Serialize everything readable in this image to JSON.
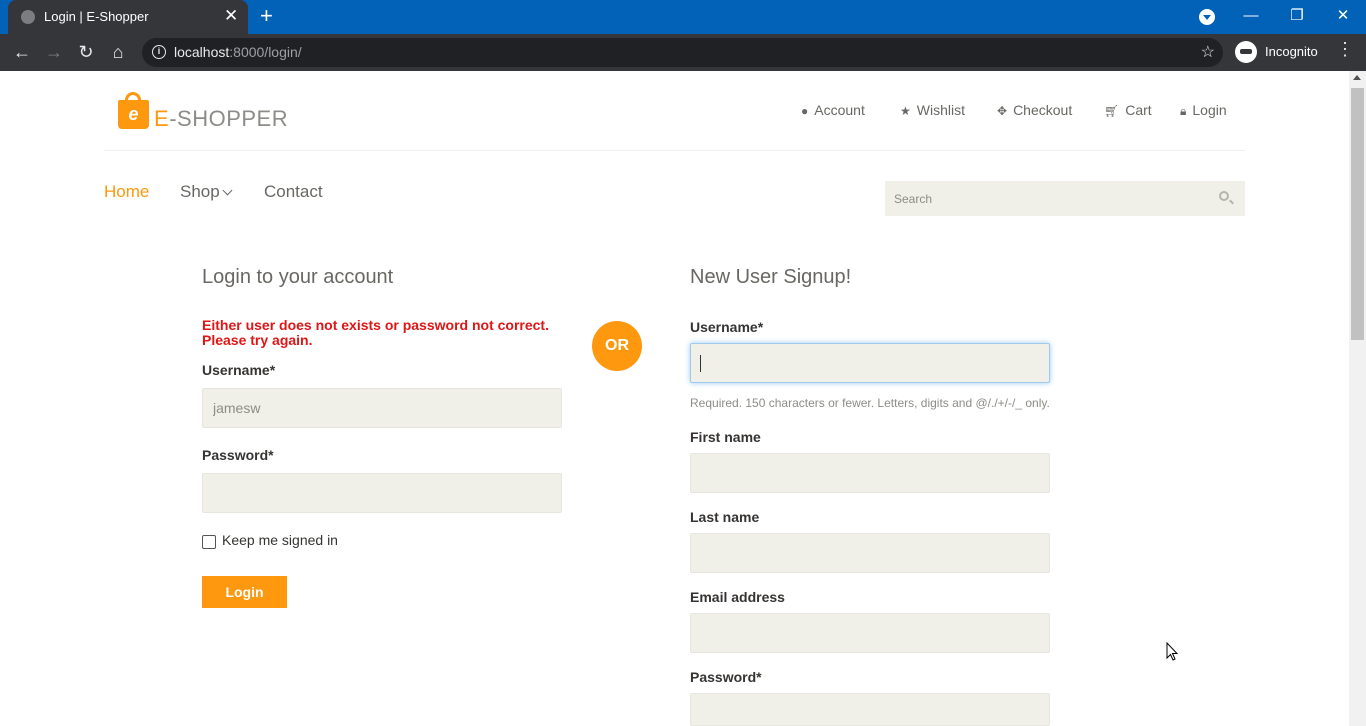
{
  "browser": {
    "tab_title": "Login | E-Shopper",
    "tab_close": "✕",
    "new_tab": "+",
    "url_host": "localhost",
    "url_rest": ":8000/login/",
    "profile_label": "Incognito",
    "window_controls": {
      "minimize": "—",
      "restore": "❐",
      "close": "✕"
    }
  },
  "header": {
    "logo_e": "E",
    "logo_rest": "-SHOPPER",
    "logo_bag_letter": "e",
    "top_nav": [
      {
        "label": "Account",
        "icon": "user-icon"
      },
      {
        "label": "Wishlist",
        "icon": "star-icon"
      },
      {
        "label": "Checkout",
        "icon": "crosshairs-icon"
      },
      {
        "label": "Cart",
        "icon": "cart-icon"
      },
      {
        "label": "Login",
        "icon": "lock-icon"
      }
    ],
    "main_nav": {
      "home": "Home",
      "shop": "Shop",
      "contact": "Contact"
    },
    "search_placeholder": "Search"
  },
  "login": {
    "title": "Login to your account",
    "error": "Either user does not exists or password not correct. Please try again.",
    "username_label": "Username*",
    "username_value": "jamesw",
    "password_label": "Password*",
    "password_value": "",
    "keep_signed_in": "Keep me signed in",
    "button": "Login"
  },
  "or_label": "OR",
  "signup": {
    "title": "New User Signup!",
    "username_label": "Username*",
    "username_help": "Required. 150 characters or fewer. Letters, digits and @/./+/-/_ only.",
    "first_name_label": "First name",
    "last_name_label": "Last name",
    "email_label": "Email address",
    "password_label": "Password*"
  },
  "colors": {
    "accent": "#fe980f",
    "error": "#e01515",
    "field_bg": "#f0f0e9",
    "chrome_blue": "#0262b8",
    "chrome_dark": "#35363a"
  }
}
